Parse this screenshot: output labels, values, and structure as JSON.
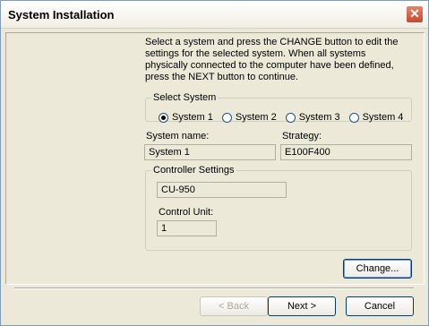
{
  "window": {
    "title": "System Installation"
  },
  "instructions": "Select a system and press the CHANGE button to edit the settings for the selected system. When all systems physically connected to the computer have been defined, press the NEXT button to continue.",
  "select_system": {
    "legend": "Select System",
    "options": [
      "System 1",
      "System 2",
      "System 3",
      "System 4"
    ],
    "selected": "System 1"
  },
  "system_name": {
    "label": "System name:",
    "value": "System 1"
  },
  "strategy": {
    "label": "Strategy:",
    "value": "E100F400"
  },
  "controller": {
    "legend": "Controller Settings",
    "type_value": "CU-950",
    "control_unit_label": "Control Unit:",
    "control_unit_value": "1"
  },
  "buttons": {
    "change": "Change...",
    "back": "< Back",
    "next": "Next >",
    "cancel": "Cancel"
  }
}
